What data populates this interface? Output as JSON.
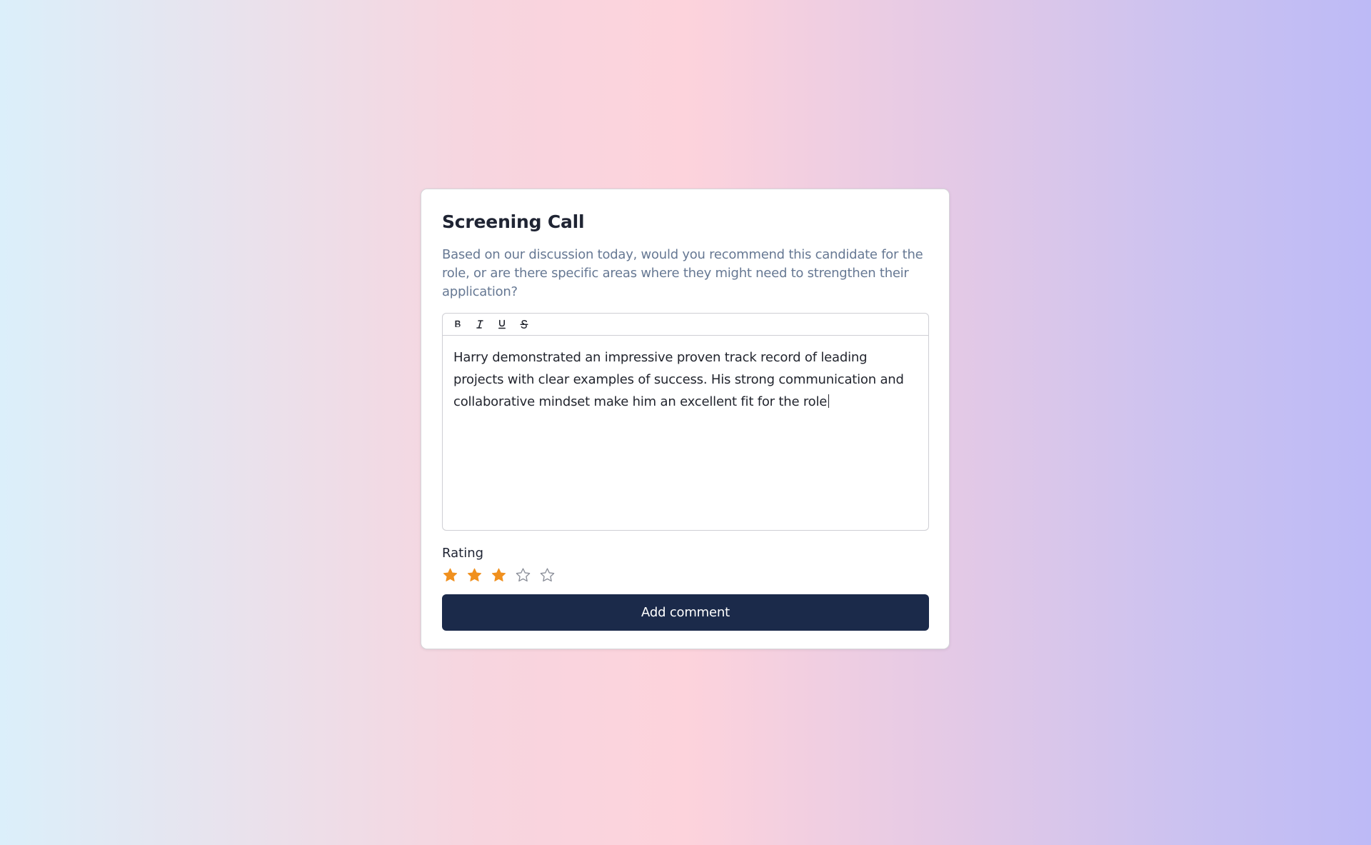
{
  "card": {
    "title": "Screening Call",
    "question": "Based on our discussion today, would you recommend this candidate for the role, or are there specific areas where they might need to strengthen their application?"
  },
  "editor": {
    "toolbar": [
      {
        "icon": "bold-icon",
        "name": "bold"
      },
      {
        "icon": "italic-icon",
        "name": "italic"
      },
      {
        "icon": "underline-icon",
        "name": "underline"
      },
      {
        "icon": "strikethrough-icon",
        "name": "strikethrough"
      }
    ],
    "value": "Harry demonstrated an impressive proven track record of leading projects with clear examples of success. His strong communication and collaborative mindset make him an excellent fit for the role"
  },
  "rating": {
    "label": "Rating",
    "value": 3,
    "max": 5,
    "filled_color": "#f0901e",
    "empty_color": "#8b8f99"
  },
  "submit": {
    "label": "Add comment",
    "color": "#1b2a4a"
  }
}
